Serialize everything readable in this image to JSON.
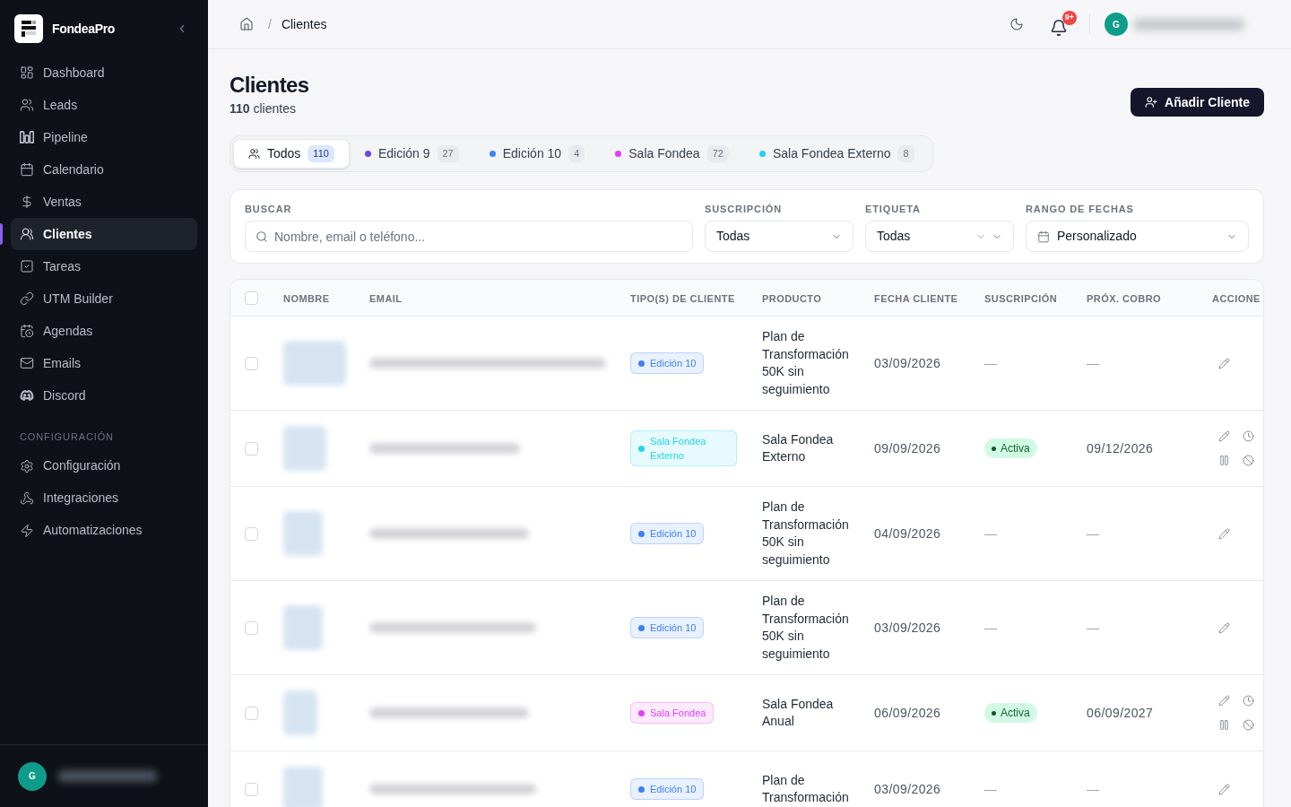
{
  "sidebar": {
    "brand": "FondeaPro",
    "nav": [
      {
        "label": "Dashboard",
        "selected": false
      },
      {
        "label": "Leads",
        "selected": false
      },
      {
        "label": "Pipeline",
        "selected": false
      },
      {
        "label": "Calendario",
        "selected": false
      },
      {
        "label": "Ventas",
        "selected": false
      },
      {
        "label": "Clientes",
        "selected": true
      },
      {
        "label": "Tareas",
        "selected": false
      },
      {
        "label": "UTM Builder",
        "selected": false
      },
      {
        "label": "Agendas",
        "selected": false
      },
      {
        "label": "Emails",
        "selected": false
      },
      {
        "label": "Discord",
        "selected": false
      }
    ],
    "section_title": "CONFIGURACIÓN",
    "config": [
      {
        "label": "Configuración",
        "selected": false
      },
      {
        "label": "Integraciones",
        "selected": false
      },
      {
        "label": "Automatizaciones",
        "selected": false
      }
    ],
    "user": {
      "initial": "G"
    }
  },
  "topbar": {
    "separator": "/",
    "breadcrumb": "Clientes",
    "notifications": "9+",
    "user": {
      "initial": "G"
    }
  },
  "page": {
    "title": "Clientes",
    "subtitle": "**110** clientes",
    "add_button": "Añadir Cliente"
  },
  "tabs": [
    {
      "kind": "all",
      "label": "Todos",
      "count": "110",
      "selected": true
    },
    {
      "kind": "tag",
      "label": "Edición 9",
      "count": "27",
      "color": "#6d47e6",
      "selected": false
    },
    {
      "kind": "tag",
      "label": "Edición 10",
      "count": "4",
      "color": "#3b82f6",
      "selected": false
    },
    {
      "kind": "tag",
      "label": "Sala Fondea",
      "count": "72",
      "color": "#e040fb",
      "selected": false
    },
    {
      "kind": "tag",
      "label": "Sala Fondea Externo",
      "count": "8",
      "color": "#22d3ee",
      "selected": false
    }
  ],
  "filters": [
    {
      "kind": "search",
      "label": "BUSCAR",
      "placeholder": "Nombre, email o teléfono..."
    },
    {
      "kind": "select",
      "label": "SUSCRIPCIÓN",
      "value": "Todas"
    },
    {
      "kind": "multiselect",
      "label": "ETIQUETA",
      "value": "Todas"
    },
    {
      "kind": "date",
      "label": "RANGO DE FECHAS",
      "value": "Personalizado"
    }
  ],
  "table": {
    "all_checked": false,
    "columns": [
      "NOMBRE",
      "EMAIL",
      "TIPO(S) DE CLIENTE",
      "PRODUCTO",
      "FECHA CLIENTE",
      "SUSCRIPCIÓN",
      "PRÓX. COBRO",
      "ACCIONE"
    ],
    "rows": [
      {
        "checked": false,
        "type": {
          "label": "Edición 10",
          "color": "#3b82f6"
        },
        "product": "Plan de Transformación 50K sin seguimiento",
        "date": "03/09/2026",
        "subscription": {
          "active": false,
          "label": "—"
        },
        "next_charge": "—"
      },
      {
        "checked": false,
        "type": {
          "label": "Sala Fondea Externo",
          "color": "#22d3ee"
        },
        "product": "Sala Fondea Externo",
        "date": "09/09/2026",
        "subscription": {
          "active": true,
          "label": "Activa"
        },
        "next_charge": "09/12/2026"
      },
      {
        "checked": false,
        "type": {
          "label": "Edición 10",
          "color": "#3b82f6"
        },
        "product": "Plan de Transformación 50K sin seguimiento",
        "date": "04/09/2026",
        "subscription": {
          "active": false,
          "label": "—"
        },
        "next_charge": "—"
      },
      {
        "checked": false,
        "type": {
          "label": "Edición 10",
          "color": "#3b82f6"
        },
        "product": "Plan de Transformación 50K sin seguimiento",
        "date": "03/09/2026",
        "subscription": {
          "active": false,
          "label": "—"
        },
        "next_charge": "—"
      },
      {
        "checked": false,
        "type": {
          "label": "Sala Fondea",
          "color": "#e040fb"
        },
        "product": "Sala Fondea Anual",
        "date": "06/09/2026",
        "subscription": {
          "active": true,
          "label": "Activa"
        },
        "next_charge": "06/09/2027"
      },
      {
        "checked": false,
        "type": {
          "label": "Edición 10",
          "color": "#3b82f6"
        },
        "product": "Plan de Transformación",
        "date": "03/09/2026",
        "subscription": {
          "active": false,
          "label": "—"
        },
        "next_charge": "—"
      }
    ]
  }
}
